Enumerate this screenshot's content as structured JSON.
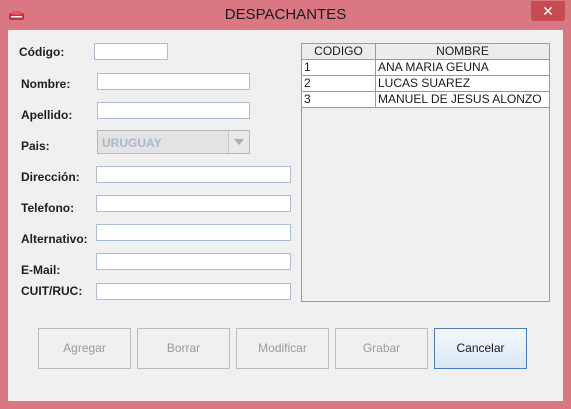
{
  "window": {
    "title": "DESPACHANTES",
    "close_label": "✕"
  },
  "form": {
    "codigo_label": "Código:",
    "nombre_label": "Nombre:",
    "apellido_label": "Apellido:",
    "pais_label": "Pais:",
    "direccion_label": "Dirección:",
    "telefono_label": "Telefono:",
    "alternativo_label": "Alternativo:",
    "email_label": "E-Mail:",
    "cuit_label": "CUIT/RUC:",
    "codigo_value": "",
    "nombre_value": "",
    "apellido_value": "",
    "pais_value": "URUGUAY",
    "direccion_value": "",
    "telefono_value": "",
    "alternativo_value": "",
    "email_value": "",
    "cuit_value": ""
  },
  "table": {
    "headers": [
      "CODIGO",
      "NOMBRE"
    ],
    "rows": [
      [
        "1",
        "ANA MARIA GEUNA"
      ],
      [
        "2",
        "LUCAS SUAREZ"
      ],
      [
        "3",
        "MANUEL DE JESUS ALONZO"
      ]
    ]
  },
  "buttons": {
    "agregar": "Agregar",
    "borrar": "Borrar",
    "modificar": "Modificar",
    "grabar": "Grabar",
    "cancelar": "Cancelar"
  },
  "icons": {
    "app": "app-logo-icon",
    "close": "close-icon",
    "dropdown": "chevron-down-icon"
  },
  "colors": {
    "window_frame": "#d97782",
    "close_button": "#c74b50",
    "field_border": "#aebdd0",
    "disabled_text": "#a9b8cc"
  }
}
